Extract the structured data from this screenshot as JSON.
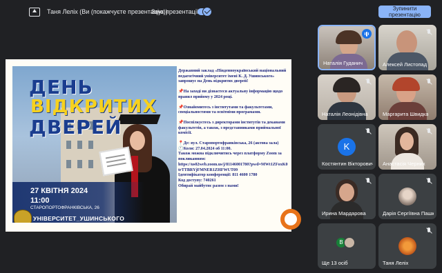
{
  "topbar": {
    "presenter_text": "Таня Леліх (Ви (покажчуєте презентацію))",
    "audio_label": "Звук презентації",
    "audio_on": true,
    "stop_button": "Зупинити презентацію"
  },
  "slide": {
    "title_line1": "ДЕНЬ",
    "title_line2": "ВІДКРИТИХ",
    "title_line3": "ДВЕРЕЙ",
    "date": "27 КВІТНЯ 2024",
    "time": "11:00",
    "address": "СТАРОПОРТОФРАНКІВСЬКА, 26",
    "university": "УНІВЕРСИТЕТ_УШИНСЬКОГО",
    "text_p1": "Державний заклад «Південноукраїнський національний педагогічний університет імені К. Д. Ушинського» запрошує на День відкритих дверей!",
    "text_p2": "📌На заході ви дізнаєтеся актуальну інформацію щодо правил прийому у 2024 році.",
    "text_p3": "📌Ознайомитесь з інститутами та факультетами, спеціальностями та освітніми програмами.",
    "text_p4": "📌Поспілкуєтесь з директорами інститутів та деканами факультетів, а також, з представниками приймальної комісії.",
    "text_p5_l1": "📍Де: вул. Старопортофранківська, 26 (актова зала)",
    "text_p5_l2": "🕚Коли: 27.04.2024 об 11:00.",
    "text_p5_l3": "Також можна підключитись через платформу Zoom за покликанням:",
    "text_p5_l4": "https://us02web.zoom.us/j/81146001780?pwd=MWt1ZFoxK0trTTBRYjFMNER1ZHFWUT09",
    "text_p5_l5": "Ідентифікатор конференції: 811 4600 1780",
    "text_p5_l6": "Код доступу: 740261",
    "text_p5_l7": "Обирай майбутнє разом з нами!"
  },
  "participants": [
    {
      "name": "Наталія Гуданич",
      "state": "speaking"
    },
    {
      "name": "Алексей Листопад",
      "state": "muted"
    },
    {
      "name": "Наталія Леонідівна",
      "state": "muted"
    },
    {
      "name": "Маргарита Швидка",
      "state": "muted"
    },
    {
      "name": "Костянтин Вікторович",
      "state": "muted",
      "avatar_letter": "K"
    },
    {
      "name": "Анастасія Черних",
      "state": "muted"
    },
    {
      "name": "Ирина Мардарова",
      "state": "muted"
    },
    {
      "name": "Дарія Сергіївна Пашко",
      "state": "muted"
    },
    {
      "name": "Ще 13 осіб",
      "state": "more",
      "avatar_letter": "В"
    },
    {
      "name": "Таня Леліх",
      "state": "muted"
    }
  ],
  "colors": {
    "accent": "#8ab4f8",
    "tile": "#3c4043",
    "bg": "#202124"
  }
}
